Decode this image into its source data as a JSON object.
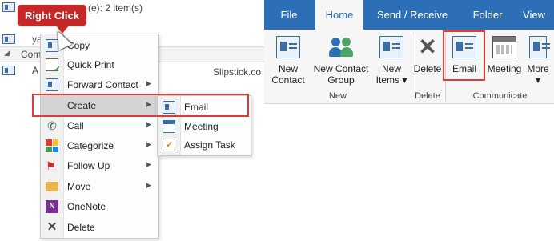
{
  "list": {
    "group_header_text": "(e): 2 item(s)",
    "row_text": "ya",
    "group_row_text": "Comp",
    "contact_text": "A",
    "site_text": "Slipstick.co"
  },
  "callout": {
    "text": "Right Click"
  },
  "context_menu": {
    "items": [
      {
        "label": "Copy",
        "icon": "copy-icon",
        "arrow": ""
      },
      {
        "label": "Quick Print",
        "icon": "quick-print-icon",
        "arrow": ""
      },
      {
        "label": "Forward Contact",
        "icon": "forward-contact-icon",
        "arrow": "▶"
      },
      {
        "label": "Create",
        "icon": "",
        "arrow": "▶"
      },
      {
        "label": "Call",
        "icon": "phone-icon",
        "arrow": "▶"
      },
      {
        "label": "Categorize",
        "icon": "categorize-icon",
        "arrow": "▶"
      },
      {
        "label": "Follow Up",
        "icon": "flag-icon",
        "arrow": "▶"
      },
      {
        "label": "Move",
        "icon": "folder-icon",
        "arrow": "▶"
      },
      {
        "label": "OneNote",
        "icon": "onenote-icon",
        "arrow": ""
      },
      {
        "label": "Delete",
        "icon": "delete-icon",
        "arrow": ""
      }
    ]
  },
  "submenu": {
    "items": [
      {
        "label": "Email",
        "icon": "email-icon"
      },
      {
        "label": "Meeting",
        "icon": "meeting-icon"
      },
      {
        "label": "Assign Task",
        "icon": "assign-task-icon"
      }
    ]
  },
  "ribbon": {
    "tabs": [
      "File",
      "Home",
      "Send / Receive",
      "Folder",
      "View"
    ],
    "active_tab": "Home",
    "groups": {
      "new": {
        "label": "New",
        "buttons": [
          {
            "line1": "New",
            "line2": "Contact",
            "icon": "new-contact-icon"
          },
          {
            "line1": "New Contact",
            "line2": "Group",
            "icon": "new-contact-group-icon"
          },
          {
            "line1": "New",
            "line2": "Items ▾",
            "icon": "new-items-icon"
          }
        ]
      },
      "delete": {
        "label": "Delete",
        "buttons": [
          {
            "line1": "Delete",
            "line2": "",
            "icon": "delete-icon"
          }
        ]
      },
      "communicate": {
        "label": "Communicate",
        "buttons": [
          {
            "line1": "Email",
            "line2": "",
            "icon": "email-icon"
          },
          {
            "line1": "Meeting",
            "line2": "",
            "icon": "meeting-icon"
          },
          {
            "line1": "More",
            "line2": "▾",
            "icon": "more-icon"
          }
        ]
      }
    }
  },
  "colors": {
    "ribbon_blue": "#2c6fb6",
    "highlight_red": "#e53935",
    "callout_red": "#c62828",
    "menu_highlight": "#d4d4d4"
  }
}
